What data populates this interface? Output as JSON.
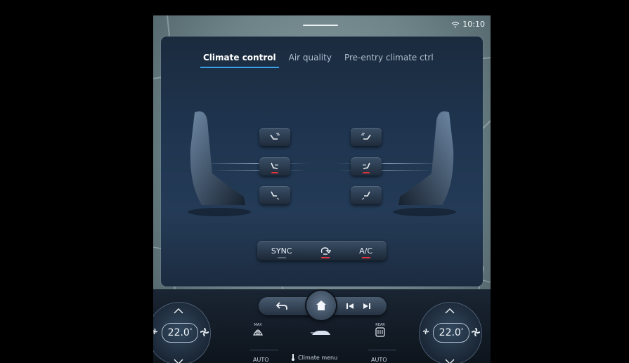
{
  "status": {
    "time": "10:10",
    "wifi_icon": "wifi-icon"
  },
  "tabs": [
    {
      "label": "Climate control",
      "active": true
    },
    {
      "label": "Air quality",
      "active": false
    },
    {
      "label": "Pre-entry climate ctrl",
      "active": false
    }
  ],
  "vents": {
    "left": [
      {
        "icon": "airflow-upper-left-icon",
        "active": false
      },
      {
        "icon": "airflow-middle-left-icon",
        "active": true
      },
      {
        "icon": "airflow-lower-left-icon",
        "active": false
      }
    ],
    "right": [
      {
        "icon": "airflow-upper-right-icon",
        "active": false
      },
      {
        "icon": "airflow-middle-right-icon",
        "active": true
      },
      {
        "icon": "airflow-lower-right-icon",
        "active": false
      }
    ]
  },
  "controls": {
    "sync_label": "SYNC",
    "recirc_icon": "recirculation-icon",
    "ac_label": "A/C"
  },
  "dock": {
    "left_temp": "22.0",
    "right_temp": "22.0",
    "auto_left": "AUTO",
    "climate_menu": "Climate menu",
    "auto_right": "AUTO",
    "max_front_label": "MAX",
    "max_rear_label": "REAR"
  },
  "colors": {
    "accent": "#3aa0e8",
    "active_indicator": "#e0343e"
  }
}
